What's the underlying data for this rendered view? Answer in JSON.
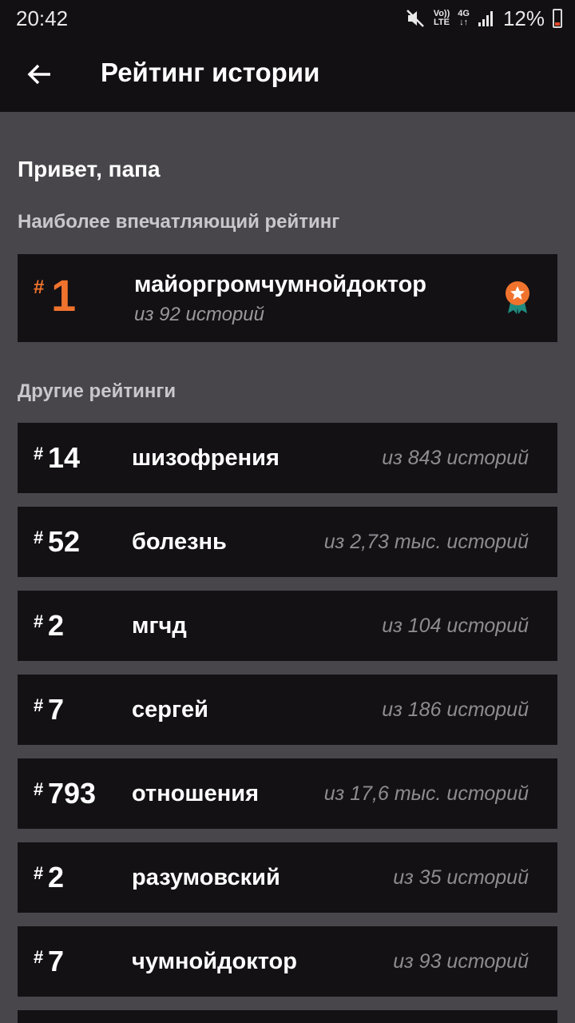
{
  "status_bar": {
    "time": "20:42",
    "volte": "Vo)) LTE",
    "network": "4G",
    "battery": "12%",
    "icons": [
      "mute-icon",
      "volte-icon",
      "4g-icon",
      "signal-icon",
      "battery-icon"
    ]
  },
  "app_bar": {
    "title": "Рейтинг истории",
    "back_icon": "arrow-left-icon"
  },
  "greeting": "Привет, папа",
  "featured_section": {
    "label": "Наиболее впечатляющий рейтинг",
    "item": {
      "hash": "#",
      "rank": "1",
      "name": "майоргромчумнойдоктор",
      "count": "из 92 историй",
      "badge_icon": "award-ribbon-icon"
    }
  },
  "other_section": {
    "label": "Другие рейтинги",
    "items": [
      {
        "hash": "#",
        "rank": "14",
        "name": "шизофрения",
        "count": "из 843 историй"
      },
      {
        "hash": "#",
        "rank": "52",
        "name": "болезнь",
        "count": "из 2,73 тыс. историй"
      },
      {
        "hash": "#",
        "rank": "2",
        "name": "мгчд",
        "count": "из 104 историй"
      },
      {
        "hash": "#",
        "rank": "7",
        "name": "сергей",
        "count": "из 186 историй"
      },
      {
        "hash": "#",
        "rank": "793",
        "name": "отношения",
        "count": "из 17,6 тыс. историй"
      },
      {
        "hash": "#",
        "rank": "2",
        "name": "разумовский",
        "count": "из 35 историй"
      },
      {
        "hash": "#",
        "rank": "7",
        "name": "чумнойдоктор",
        "count": "из 93 историй"
      }
    ]
  },
  "colors": {
    "background": "#48464b",
    "card": "#131114",
    "bar": "#121013",
    "accent": "#f0732d"
  }
}
